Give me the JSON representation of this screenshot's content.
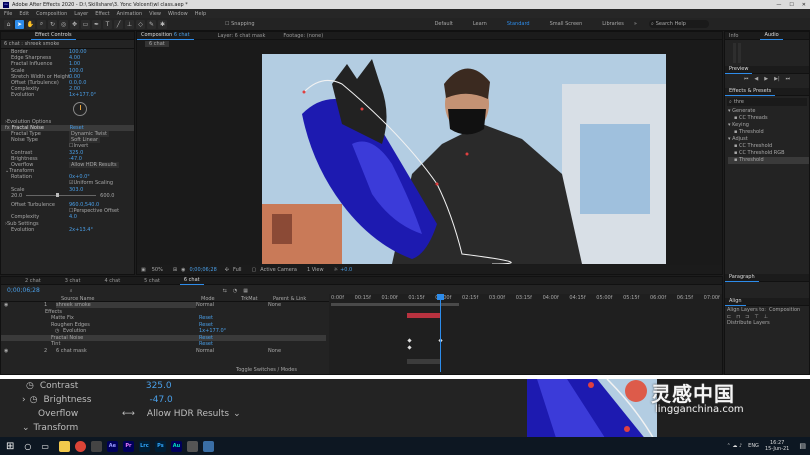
{
  "titlebar": {
    "title": "Adobe After Effects 2020 - D:\\ Skillshare\\3. Yonc Volcent\\wl class.aep *"
  },
  "menu": [
    "File",
    "Edit",
    "Composition",
    "Layer",
    "Effect",
    "Animation",
    "View",
    "Window",
    "Help"
  ],
  "toolbar": {
    "snapping": "Snapping",
    "workspaces": [
      "Default",
      "Learn",
      "Standard",
      "Small Screen",
      "Libraries"
    ],
    "search_placeholder": "Search Help"
  },
  "effect_controls": {
    "tab": "Effect Controls",
    "layer": "6 chat : shreek smoke",
    "props": [
      {
        "name": "Border",
        "value": "100.00"
      },
      {
        "name": "Edge Sharpness",
        "value": "4.00"
      },
      {
        "name": "Fractal Influence",
        "value": "1.00"
      },
      {
        "name": "Scale",
        "value": "100.0"
      },
      {
        "name": "Stretch Width or Height",
        "value": "0.00"
      },
      {
        "name": "Offset (Turbulence)",
        "value": "0.0,0.0"
      },
      {
        "name": "Complexity",
        "value": "2.00"
      },
      {
        "name": "Evolution",
        "value": "1x+177.0°"
      }
    ],
    "evolution_options": "Evolution Options",
    "fractal_noise": "Fractal Noise",
    "reset": "Reset",
    "fractal_type": {
      "name": "Fractal Type",
      "value": "Dynamic Twist"
    },
    "noise_type": {
      "name": "Noise Type",
      "value": "Soft Linear"
    },
    "invert": "Invert",
    "contrast": {
      "name": "Contrast",
      "value": "325.0"
    },
    "brightness": {
      "name": "Brightness",
      "value": "-47.0"
    },
    "overflow": {
      "name": "Overflow",
      "value": "Allow HDR Results"
    },
    "transform": "Transform",
    "rotation": {
      "name": "Rotation",
      "value": "0x+0.0°"
    },
    "uniform_scaling": "Uniform Scaling",
    "scale": {
      "name": "Scale",
      "value": "303.0"
    },
    "scale_min": "20.0",
    "scale_max": "600.0",
    "offset_turbulence": {
      "name": "Offset Turbulence",
      "value": "960.0,540.0"
    },
    "perspective_offset": "Perspective Offset",
    "complexity": {
      "name": "Complexity",
      "value": "4.0"
    },
    "sub_settings": "Sub Settings",
    "evolution2": {
      "name": "Evolution",
      "value": "2x+13.4°"
    }
  },
  "composition": {
    "tab": "Composition",
    "comp_name": "6 chat",
    "layer_tab": "Layer: 6 chat mask",
    "footage_tab": "Footage: (none)",
    "bottom": {
      "zoom": "50%",
      "time": "0;00;06;28",
      "quality": "Full",
      "camera": "Active Camera",
      "view": "1 View",
      "exposure": "+0.0"
    }
  },
  "right": {
    "info": "Info",
    "audio": "Audio",
    "preview": "Preview",
    "effects_presets": "Effects & Presets",
    "search_value": "thre",
    "tree": [
      {
        "label": "Generate",
        "indent": 0
      },
      {
        "label": "CC Threads",
        "indent": 1
      },
      {
        "label": "Keying",
        "indent": 0
      },
      {
        "label": "Threshold",
        "indent": 1
      },
      {
        "label": "Adjust",
        "indent": 0
      },
      {
        "label": "CC Threshold",
        "indent": 1
      },
      {
        "label": "CC Threshold RGB",
        "indent": 1
      },
      {
        "label": "Threshold",
        "indent": 1
      }
    ],
    "paragraph": "Paragraph",
    "align": "Align",
    "align_to": "Align Layers to:",
    "align_to_value": "Composition",
    "distribute": "Distribute Layers"
  },
  "timeline": {
    "tabs": [
      "2 chat",
      "3 chat",
      "4 chat",
      "5 chat",
      "6 chat"
    ],
    "timecode": "0;00;06;28",
    "header": {
      "source": "Source Name",
      "mode": "Mode",
      "trkmat": "TrkMat",
      "parent": "Parent & Link"
    },
    "rows": [
      {
        "num": "1",
        "name": "shreek smoke",
        "mode": "Normal",
        "parent": "None"
      },
      {
        "num": "",
        "name": "Effects",
        "mode": "",
        "parent": ""
      },
      {
        "num": "",
        "name": "Matte Fix",
        "mode": "Reset",
        "parent": ""
      },
      {
        "num": "",
        "name": "Roughen Edges",
        "mode": "Reset",
        "parent": ""
      },
      {
        "num": "",
        "name": "Evolution",
        "mode": "1x+177.0°",
        "parent": ""
      },
      {
        "num": "",
        "name": "Fractal Noise",
        "mode": "Reset",
        "parent": ""
      },
      {
        "num": "",
        "name": "Tint",
        "mode": "Reset",
        "parent": ""
      },
      {
        "num": "2",
        "name": "6 chat mask",
        "mode": "Normal",
        "parent": "None"
      }
    ],
    "ruler": [
      "0:00f",
      "00:15f",
      "01:00f",
      "01:15f",
      "02:00f",
      "02:15f",
      "03:00f",
      "03:15f",
      "04:00f",
      "04:15f",
      "05:00f",
      "05:15f",
      "06:00f",
      "06:15f",
      "07:00f"
    ],
    "toggle": "Toggle Switches / Modes"
  },
  "zoom": {
    "contrast": {
      "name": "Contrast",
      "value": "325.0"
    },
    "brightness": {
      "name": "Brightness",
      "value": "-47.0"
    },
    "overflow": {
      "name": "Overflow",
      "value": "Allow HDR Results"
    },
    "transform": "Transform"
  },
  "watermark": {
    "text": "lingganchina.com"
  },
  "taskbar": {
    "apps": [
      "Ae",
      "Pr",
      "Lrc",
      "Ps",
      "Au"
    ],
    "lang": "ENG",
    "time": "16:27",
    "date": "15-Jun-21"
  },
  "colors": {
    "accent": "#2d8ceb",
    "sky": "#a9c6de",
    "smoke": "#1d1ab0"
  }
}
